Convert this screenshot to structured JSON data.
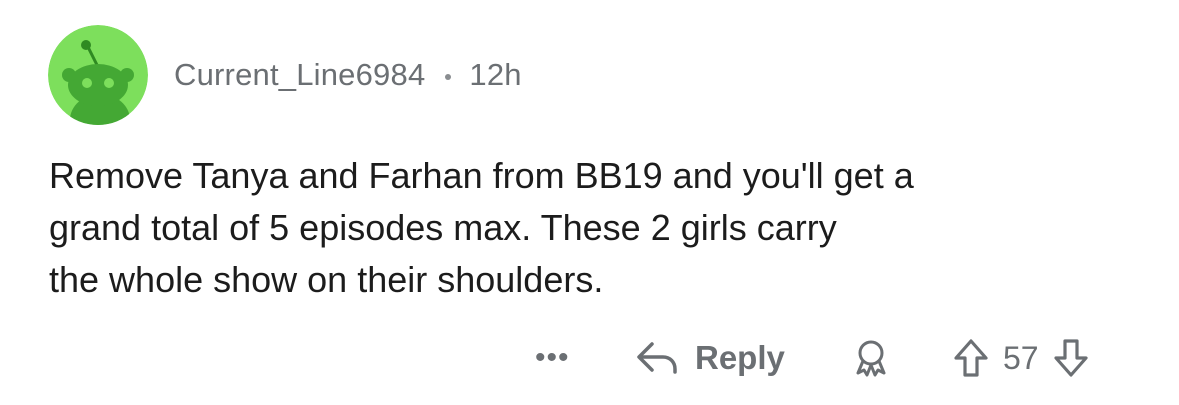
{
  "comment": {
    "username": "Current_Line6984",
    "separator": "•",
    "age": "12h",
    "body_lines": [
      "Remove Tanya and Farhan from BB19 and you'll get a",
      "grand total of 5 episodes max. These 2 girls carry",
      "the whole show on their shoulders."
    ]
  },
  "actions": {
    "more_label": "•••",
    "reply_label": "Reply",
    "score": "57"
  },
  "icons": {
    "avatar": "snoo-avatar-icon",
    "reply": "reply-arrow-icon",
    "award": "award-icon",
    "upvote": "upvote-arrow-icon",
    "downvote": "downvote-arrow-icon"
  },
  "colors": {
    "avatar_bg": "#7ddf5c",
    "avatar_figure": "#3fa42e",
    "muted_text": "#6b6f73",
    "body_text": "#1c1c1c"
  }
}
